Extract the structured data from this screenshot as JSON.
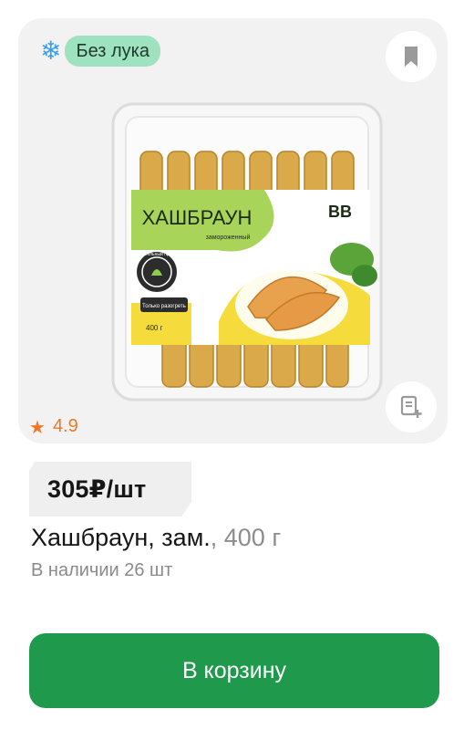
{
  "badge": {
    "icon": "snowflake-icon",
    "label": "Без лука"
  },
  "icons": {
    "bookmark": "bookmark-icon",
    "note": "note-add-icon"
  },
  "product_photo": {
    "package_title": "ХАШБРАУН",
    "package_subtitle": "замороженный",
    "brand": "ВВ",
    "stamp": "Растительный продукт",
    "hint": "Только разогреть",
    "package_weight": "400 г"
  },
  "rating": {
    "value": "4.9"
  },
  "price": {
    "label": "305₽/шт"
  },
  "product": {
    "name": "Хашбраун, зам.",
    "weight": ", 400 г"
  },
  "stock": {
    "label": "В наличии 26 шт"
  },
  "cart_button": {
    "label": "В корзину"
  },
  "colors": {
    "accent_green": "#1f9a4d",
    "badge_bg": "#9fe2c0",
    "rating_orange": "#f0772a"
  }
}
